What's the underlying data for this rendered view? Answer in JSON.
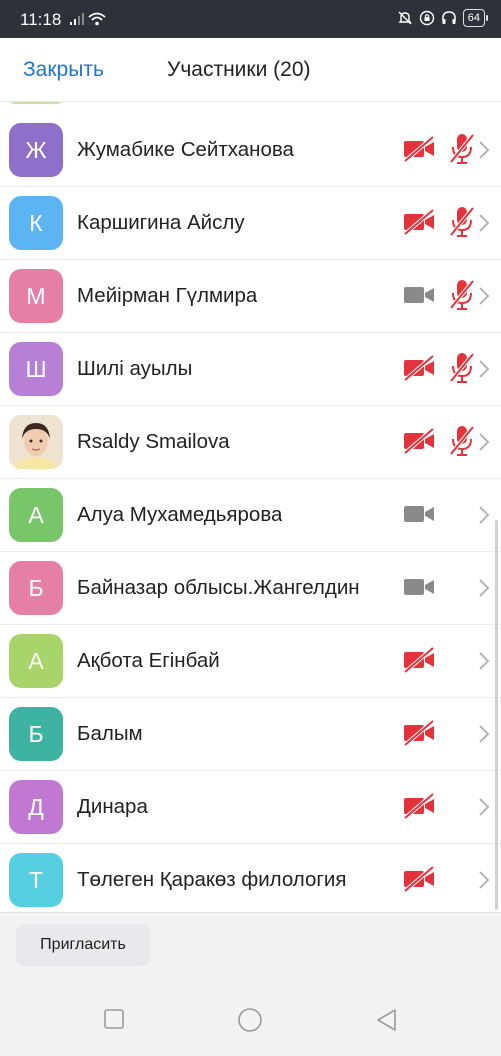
{
  "status_bar": {
    "time": "11:18",
    "battery": "64"
  },
  "header": {
    "close_label": "Закрыть",
    "title": "Участники (20)"
  },
  "participants": [
    {
      "initial": "Ж",
      "name": "Жумабике Сейтханова",
      "color": "#8e6fc9",
      "video": "off",
      "audio": "muted"
    },
    {
      "initial": "К",
      "name": "Каршигина Айслу",
      "color": "#5cb5f2",
      "video": "off",
      "audio": "muted"
    },
    {
      "initial": "М",
      "name": "Мейірман Гүлмира",
      "color": "#e57fa6",
      "video": "on",
      "audio": "muted"
    },
    {
      "initial": "Ш",
      "name": "Шилі ауылы",
      "color": "#b77fd6",
      "video": "off",
      "audio": "muted"
    },
    {
      "initial": "",
      "name": "Rsaldy Smailova",
      "color": "#e9d8c2",
      "photo": true,
      "video": "off",
      "audio": "muted"
    },
    {
      "initial": "А",
      "name": "Алуа Мухамедьярова",
      "color": "#79c56a",
      "video": "on",
      "audio": "none"
    },
    {
      "initial": "Б",
      "name": "Байназар  облысы.Жангелдин",
      "color": "#e57fa6",
      "video": "on",
      "audio": "none"
    },
    {
      "initial": "А",
      "name": "Ақбота Егінбай",
      "color": "#a9d46a",
      "video": "off",
      "audio": "none"
    },
    {
      "initial": "Б",
      "name": "Балым",
      "color": "#3fb3a1",
      "video": "off",
      "audio": "none"
    },
    {
      "initial": "Д",
      "name": "Динара",
      "color": "#c078d3",
      "video": "off",
      "audio": "none"
    },
    {
      "initial": "Т",
      "name": "Төлеген Қаракөз филология",
      "color": "#56cfe0",
      "video": "off",
      "audio": "none"
    }
  ],
  "footer": {
    "invite_label": "Пригласить"
  },
  "colors": {
    "accent": "#1f75d6",
    "muted_red": "#e5333b",
    "camera_on_gray": "#8a8a8a"
  }
}
